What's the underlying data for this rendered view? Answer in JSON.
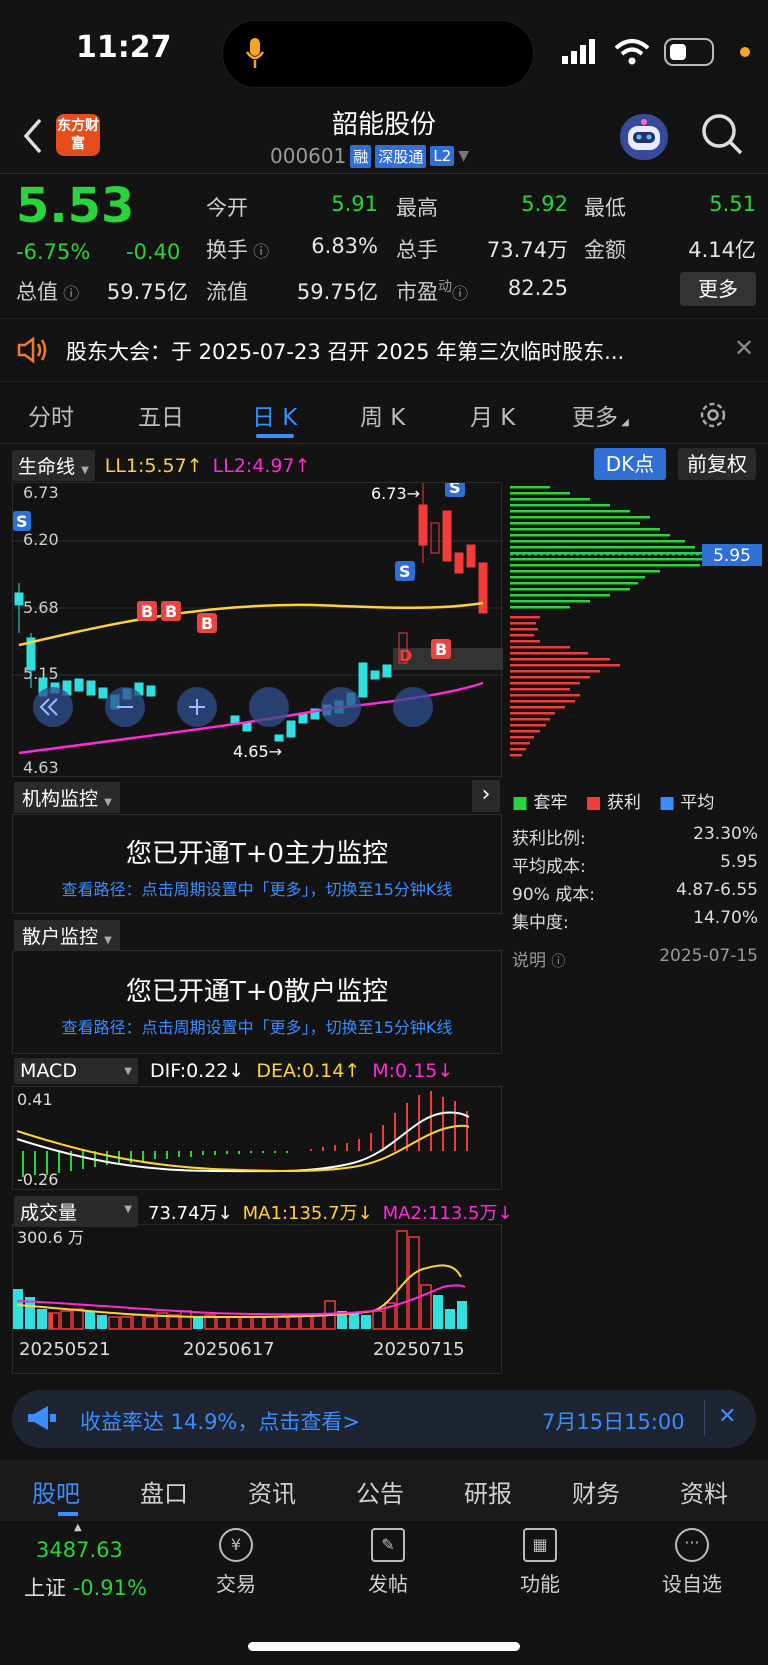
{
  "status": {
    "time": "11:27"
  },
  "header": {
    "name": "韶能股份",
    "code": "000601",
    "tags": [
      "融",
      "深股通",
      "L2"
    ],
    "logo": "东方财富"
  },
  "quote": {
    "price": "5.53",
    "pct": "-6.75%",
    "chg": "-0.40",
    "items": [
      {
        "label": "今开",
        "value": "5.91",
        "color": "#2ad43a"
      },
      {
        "label": "最高",
        "value": "5.92",
        "color": "#2ad43a"
      },
      {
        "label": "最低",
        "value": "5.51",
        "color": "#2ad43a"
      },
      {
        "label": "换手",
        "value": "6.83%",
        "color": "#e6e6e6"
      },
      {
        "label": "总手",
        "value": "73.74万",
        "color": "#e6e6e6"
      },
      {
        "label": "金额",
        "value": "4.14亿",
        "color": "#e6e6e6"
      },
      {
        "label": "总值",
        "value": "59.75亿",
        "color": "#e6e6e6"
      },
      {
        "label": "流值",
        "value": "59.75亿",
        "color": "#e6e6e6"
      },
      {
        "label": "市盈",
        "value": "82.25",
        "color": "#e6e6e6"
      }
    ],
    "more": "更多"
  },
  "notice": {
    "text": "股东大会：于 2025-07-23 召开 2025 年第三次临时股东..."
  },
  "tabs": [
    "分时",
    "五日",
    "日 K",
    "周 K",
    "月 K",
    "更多"
  ],
  "kbar": {
    "indicator": "生命线",
    "ll1": "LL1:5.57",
    "ll2": "LL2:4.97",
    "dk": "DK点",
    "fq": "前复权"
  },
  "kchart": {
    "high": "6.73",
    "low": "4.63",
    "grid": [
      "6.20",
      "5.68",
      "5.15"
    ],
    "highMark": "6.73",
    "lowMark": "4.65",
    "profileAvg": "5.95"
  },
  "legend": {
    "a": "套牢",
    "b": "获利",
    "c": "平均"
  },
  "stats": [
    {
      "k": "获利比例:",
      "v": "23.30%"
    },
    {
      "k": "平均成本:",
      "v": "5.95"
    },
    {
      "k": "90% 成本:",
      "v": "4.87-6.55"
    },
    {
      "k": "集中度:",
      "v": "14.70%"
    }
  ],
  "statsFoot": {
    "k": "说明",
    "v": "2025-07-15"
  },
  "inst": {
    "title": "机构监控",
    "main": "您已开通T+0主力监控",
    "sub": "查看路径：点击周期设置中「更多」，切换至15分钟K线"
  },
  "retail": {
    "title": "散户监控",
    "main": "您已开通T+0散户监控",
    "sub": "查看路径：点击周期设置中「更多」，切换至15分钟K线"
  },
  "macd": {
    "title": "MACD",
    "dif": "DIF:0.22",
    "dea": "DEA:0.14",
    "m": "M:0.15",
    "top": "0.41",
    "bottom": "-0.26"
  },
  "vol": {
    "title": "成交量",
    "v": "73.74万",
    "ma1": "MA1:135.7万",
    "ma2": "MA2:113.5万",
    "top": "300.6 万",
    "dates": [
      "20250521",
      "20250617",
      "20250715"
    ]
  },
  "banner": {
    "text": "收益率达 14.9%，点击查看>",
    "time": "7月15日15:00"
  },
  "bottomTabs": [
    "股吧",
    "盘口",
    "资讯",
    "公告",
    "研报",
    "财务",
    "资料"
  ],
  "dock": {
    "index": "3487.63",
    "indexName": "上证",
    "indexPct": "-0.91%",
    "items": [
      "交易",
      "发帖",
      "功能",
      "设自选"
    ]
  }
}
